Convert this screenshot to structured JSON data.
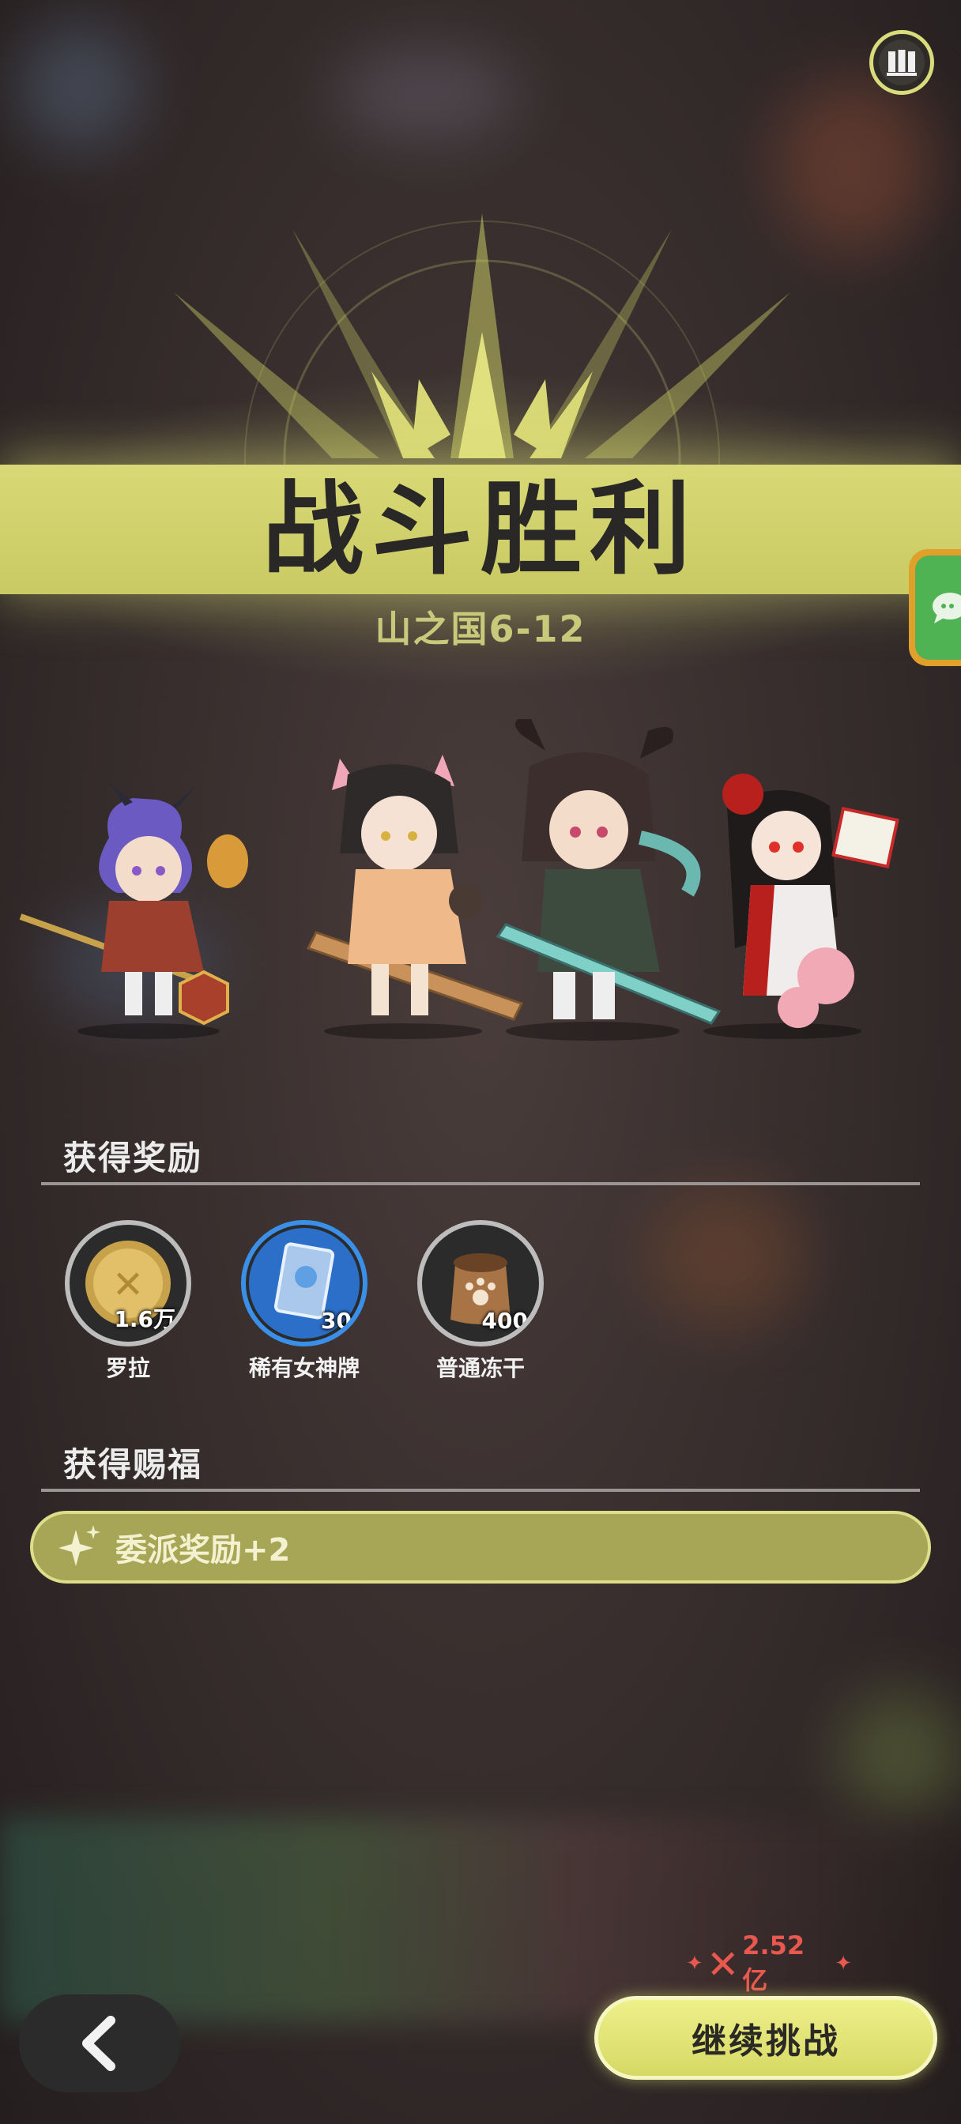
{
  "header": {
    "stats_icon": "bar-chart-icon"
  },
  "result": {
    "title": "战斗胜利",
    "stage": "山之国6-12"
  },
  "side_tab": {
    "icon": "chat-icon"
  },
  "team": {
    "heroes": [
      "hero-1",
      "hero-2",
      "hero-3",
      "hero-4"
    ]
  },
  "rewards": {
    "section_title": "获得奖励",
    "items": [
      {
        "name": "罗拉",
        "count": "1.6万",
        "icon": "gold-coin-icon",
        "rarity": "normal"
      },
      {
        "name": "稀有女神牌",
        "count": "30",
        "icon": "goddess-card-icon",
        "rarity": "rare"
      },
      {
        "name": "普通冻干",
        "count": "400",
        "icon": "food-bag-icon",
        "rarity": "normal"
      }
    ]
  },
  "blessings": {
    "section_title": "获得赐福",
    "items": [
      {
        "label": "委派奖励+2",
        "icon": "sparkle-icon"
      }
    ]
  },
  "footer": {
    "back_icon": "chevron-left-icon",
    "power": "2.52亿",
    "continue_label": "继续挑战"
  },
  "colors": {
    "accent": "#d8d976",
    "rare": "#3a8fe8",
    "power": "#e9584e"
  }
}
